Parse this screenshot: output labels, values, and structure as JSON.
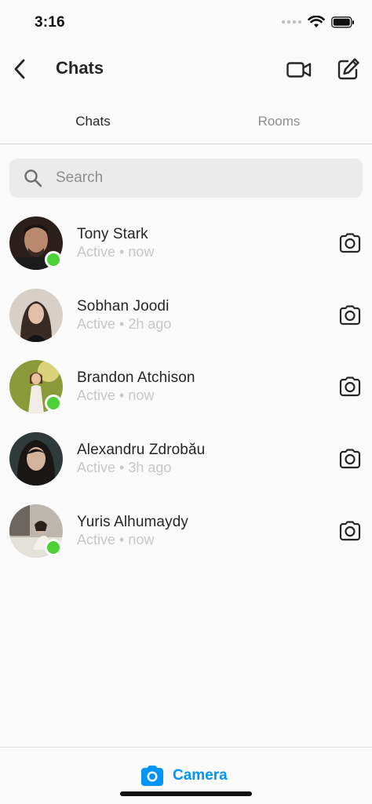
{
  "status_bar": {
    "time": "3:16"
  },
  "nav": {
    "title": "Chats"
  },
  "tabs": [
    {
      "label": "Chats",
      "active": true
    },
    {
      "label": "Rooms",
      "active": false
    }
  ],
  "search": {
    "placeholder": "Search"
  },
  "chats": [
    {
      "name": "Tony Stark",
      "status": "Active • now",
      "online": true
    },
    {
      "name": "Sobhan Joodi",
      "status": "Active • 2h ago",
      "online": false
    },
    {
      "name": "Brandon Atchison",
      "status": "Active • now",
      "online": true
    },
    {
      "name": "Alexandru Zdrobău",
      "status": "Active • 3h ago",
      "online": false
    },
    {
      "name": "Yuris Alhumaydy",
      "status": "Active • now",
      "online": true
    }
  ],
  "bottom": {
    "camera_label": "Camera"
  },
  "colors": {
    "accent": "#0095f6",
    "online": "#4cd137",
    "muted": "#c7c7c7"
  }
}
